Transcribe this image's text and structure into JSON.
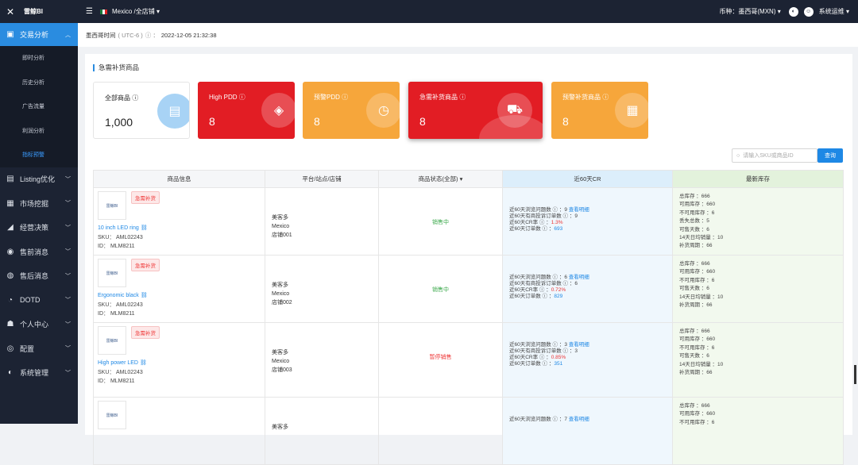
{
  "app": {
    "name": "雷鲸BI"
  },
  "sidebar": {
    "active": {
      "label": "交易分析"
    },
    "sub_items": [
      {
        "label": "即时分析"
      },
      {
        "label": "历史分析"
      },
      {
        "label": "广告流量"
      },
      {
        "label": "利润分析"
      },
      {
        "label": "指标预警"
      }
    ],
    "items": [
      {
        "label": "Listing优化",
        "icon": "list-icon"
      },
      {
        "label": "市场挖掘",
        "icon": "store-icon"
      },
      {
        "label": "经营决策",
        "icon": "chart-icon"
      },
      {
        "label": "售前消息",
        "icon": "message-icon"
      },
      {
        "label": "售后消息",
        "icon": "chat-icon"
      },
      {
        "label": "DOTD",
        "icon": "lock-icon"
      },
      {
        "label": "个人中心",
        "icon": "user-icon"
      },
      {
        "label": "配置",
        "icon": "config-icon"
      },
      {
        "label": "系统管理",
        "icon": "settings-icon"
      }
    ]
  },
  "topbar": {
    "store": "Mexico /全店铺",
    "currency": "币种：墨西哥(MXN)",
    "user": "系统运维"
  },
  "timebar": {
    "label": "墨西哥时间",
    "tz": "( UTC-6 )",
    "time": "2022-12-05 21:32:38"
  },
  "section": {
    "title": "急需补货商品"
  },
  "tiles": [
    {
      "title": "全部商品",
      "value": "1,000"
    },
    {
      "title": "High PDD",
      "value": "8"
    },
    {
      "title": "预警PDD",
      "value": "8"
    },
    {
      "title": "急需补货商品",
      "value": "8"
    },
    {
      "title": "预警补货商品",
      "value": "8"
    }
  ],
  "search": {
    "placeholder": "请输入SKU或商品ID",
    "button": "查询"
  },
  "table": {
    "headers": [
      "商品信息",
      "平台/站点/店铺",
      "商品状态(全部)",
      "近60天CR",
      "最新库存"
    ],
    "rows": [
      {
        "tag": "急需补货",
        "logo": "雷鲸BI",
        "name": "10 inch LED ring",
        "sku": "SKU：  AML02243",
        "id": "ID：  MLM8211",
        "platform": "美客多",
        "site": "Mexico",
        "shop": "店铺001",
        "status": "销售中",
        "status_color": "#3aa84a",
        "cr": [
          {
            "label": "近60天浏览问题数",
            "value": "9",
            "link": "查看明细"
          },
          {
            "label": "近60天有商投诉订单数",
            "value": "9"
          },
          {
            "label": "近60天CR率",
            "value": "1.3%"
          },
          {
            "label": "近60天订单数",
            "value": "693"
          }
        ],
        "stock": [
          "总库存 ：666",
          "可用库存 ：660",
          "不可用库存 ：6",
          "丢失总数 ：5",
          "可售天数 ：6",
          "14天日均销量 ：10",
          "补货周期 ：66"
        ]
      },
      {
        "tag": "急需补货",
        "logo": "雷鲸BI",
        "name": "Ergonomic black",
        "sku": "SKU：  AML02243",
        "id": "ID：  MLM8211",
        "platform": "美客多",
        "site": "Mexico",
        "shop": "店铺002",
        "status": "销售中",
        "status_color": "#3aa84a",
        "cr": [
          {
            "label": "近60天浏览问题数",
            "value": "6",
            "link": "查看明细"
          },
          {
            "label": "近60天有商投诉订单数",
            "value": "6"
          },
          {
            "label": "近60天CR率",
            "value": "0.72%"
          },
          {
            "label": "近60天订单数",
            "value": "829"
          }
        ],
        "stock": [
          "总库存 ：666",
          "可用库存 ：660",
          "不可用库存 ：6",
          "可售天数 ：6",
          "14天日均销量 ：10",
          "补货周期 ：66"
        ]
      },
      {
        "tag": "急需补货",
        "logo": "雷鲸BI",
        "name": "High power LED",
        "sku": "SKU：  AML02243",
        "id": "ID：  MLM8211",
        "platform": "美客多",
        "site": "Mexico",
        "shop": "店铺003",
        "status": "暂停销售",
        "status_color": "#e33",
        "cr": [
          {
            "label": "近60天浏览问题数",
            "value": "3",
            "link": "查看明细"
          },
          {
            "label": "近60天有商投诉订单数",
            "value": "3"
          },
          {
            "label": "近60天CR率",
            "value": "0.85%"
          },
          {
            "label": "近60天订单数",
            "value": "351"
          }
        ],
        "stock": [
          "总库存 ：666",
          "可用库存 ：660",
          "不可用库存 ：6",
          "可售天数 ：6",
          "14天日均销量 ：10",
          "补货周期 ：66"
        ]
      },
      {
        "tag": "",
        "logo": "雷鲸BI",
        "name": "",
        "sku": "",
        "id": "",
        "platform": "美客多",
        "site": "",
        "shop": "",
        "status": "",
        "status_color": "#3aa84a",
        "cr": [
          {
            "label": "近60天浏览问题数",
            "value": "7",
            "link": "查看明细"
          }
        ],
        "stock": [
          "总库存 ：666",
          "可用库存 ：660",
          "不可用库存 ：6"
        ]
      }
    ]
  }
}
